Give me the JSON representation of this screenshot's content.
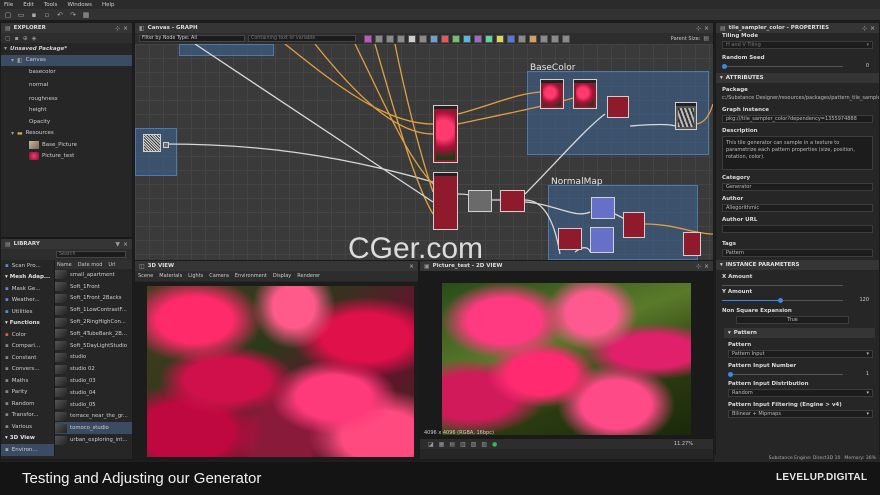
{
  "menu": [
    "File",
    "Edit",
    "Tools",
    "Windows",
    "Help"
  ],
  "explorer": {
    "title": "EXPLORER",
    "package": "Unsaved Package*",
    "canvas": "Canvas",
    "outputs": [
      "basecolor",
      "normal",
      "roughness",
      "height",
      "Opacity"
    ],
    "resources": "Resources",
    "resource_items": [
      "Base_Picture",
      "Picture_test"
    ]
  },
  "library": {
    "title": "LIBRARY",
    "search_placeholder": "Search",
    "categories": [
      {
        "label": "Scan Pro...",
        "section": false
      },
      {
        "label": "Mesh Adap...",
        "section": true
      },
      {
        "label": "Mask Ge...",
        "section": false
      },
      {
        "label": "Weather...",
        "section": false
      },
      {
        "label": "Utilities",
        "section": false
      },
      {
        "label": "Functions",
        "section": true
      },
      {
        "label": "Color",
        "section": false
      },
      {
        "label": "Compari...",
        "section": false
      },
      {
        "label": "Constant",
        "section": false
      },
      {
        "label": "Convers...",
        "section": false
      },
      {
        "label": "Maths",
        "section": false
      },
      {
        "label": "Parity",
        "section": false
      },
      {
        "label": "Random",
        "section": false
      },
      {
        "label": "Transfor...",
        "section": false
      },
      {
        "label": "Various",
        "section": false
      },
      {
        "label": "3D View",
        "section": true
      },
      {
        "label": "Environ...",
        "section": false
      }
    ],
    "columns": [
      "Name",
      "Date mod",
      "Url"
    ],
    "items": [
      "small_apartment",
      "Soft_1Front",
      "Soft_1Front_2Backs",
      "Soft_1LowContrastF...",
      "Soft_2RingHighCon...",
      "Soft_4TubeBank_2B...",
      "Soft_5DayLightStudio",
      "studio",
      "studio 02",
      "studio_03",
      "studio_04",
      "studio_05",
      "terrace_near_the_gr...",
      "tomoco_studio",
      "urban_exploring_int..."
    ]
  },
  "graph": {
    "title": "Canvas - GRAPH",
    "filter_label": "Filter by Node Type",
    "filter_value": "All",
    "contains_placeholder": "Containing text or variable",
    "parent_size": "Parent Size:",
    "frames": [
      "BaseColor",
      "NormalMap"
    ]
  },
  "view3d": {
    "title": "3D VIEW",
    "menu": [
      "Scene",
      "Materials",
      "Lights",
      "Camera",
      "Environment",
      "Display",
      "Renderer"
    ]
  },
  "view2d": {
    "title": "Picture_test - 2D VIEW",
    "info": "4096 x 4096 (RGBA, 16bpc)",
    "zoom": "11.27%"
  },
  "properties": {
    "title": "tile_sampler_color - PROPERTIES",
    "tiling_mode_label": "Tiling Mode",
    "tiling_mode_value": "H and V Tiling",
    "random_seed_label": "Random Seed",
    "random_seed_value": "0",
    "attributes": "ATTRIBUTES",
    "package_label": "Package",
    "package_value": "c:/Substance Designer/resources/packages/pattern_tile_sampler.sbs",
    "graph_instance_label": "Graph instance",
    "graph_instance_value": "pkg:///tile_sampler_color?dependency=1355974888",
    "description_label": "Description",
    "description_value": "This tile generator can sample in a texture to parametrize each pattern properties (size, position, rotation, color).",
    "category_label": "Category",
    "category_value": "Generator",
    "author_label": "Author",
    "author_value": "Allegorithmic",
    "author_url_label": "Author URL",
    "tags_label": "Tags",
    "tags_value": "Pattern",
    "instance_params": "INSTANCE PARAMETERS",
    "x_amount_label": "X Amount",
    "x_amount_value": "120",
    "y_amount_label": "Y Amount",
    "y_amount_value": "120",
    "non_square_label": "Non Square Expansion",
    "non_square_value": "True",
    "pattern_section": "Pattern",
    "pattern_label": "Pattern",
    "pattern_value": "Pattern Input",
    "pattern_input_number_label": "Pattern Input Number",
    "pattern_input_number_value": "1",
    "pattern_input_dist_label": "Pattern Input Distribution",
    "pattern_input_dist_value": "Random",
    "pattern_input_filter_label": "Pattern Input Filtering (Engine > v4)",
    "pattern_input_filter_value": "Bilinear + Mipmaps"
  },
  "status": {
    "engine": "Substance Engine: Direct3D 10",
    "memory": "Memory: 36%"
  },
  "caption": "Testing and Adjusting our Generator",
  "brand": "LEVELUP.DIGITAL",
  "watermark": "CGer.com",
  "colors": {
    "accent": "#3b88e6",
    "frame": "#4e79a8",
    "node_red": "#8e1a2c"
  }
}
